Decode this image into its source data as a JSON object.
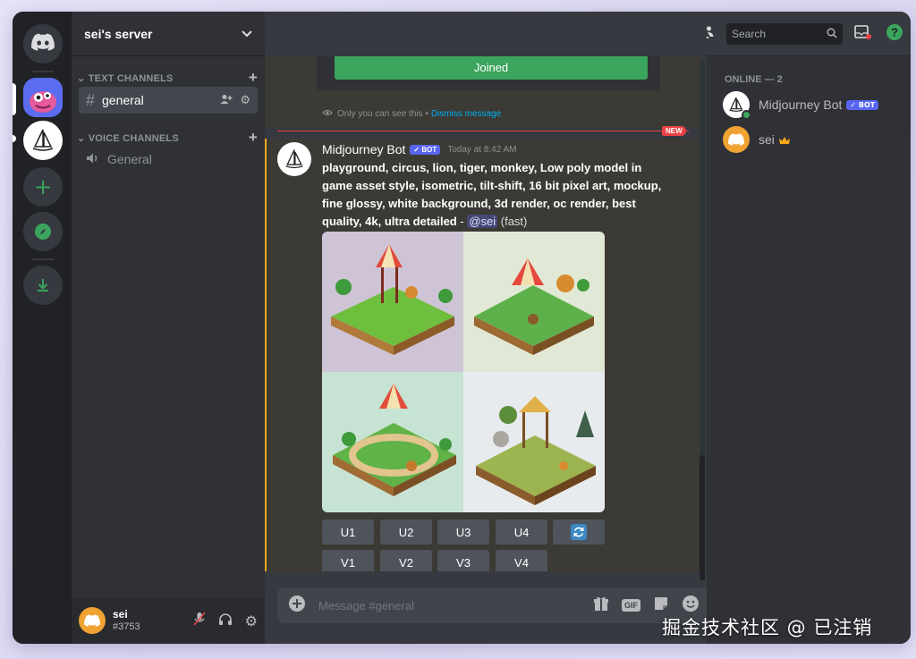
{
  "server": {
    "name": "sei's server"
  },
  "channels": {
    "text_category": "TEXT CHANNELS",
    "voice_category": "VOICE CHANNELS",
    "text_items": [
      {
        "label": "general"
      }
    ],
    "voice_items": [
      {
        "label": "General"
      }
    ]
  },
  "user": {
    "name": "sei",
    "tag": "#3753"
  },
  "header": {
    "channel": "general",
    "search_placeholder": "Search"
  },
  "prev_message": {
    "button_label": "Joined",
    "ephemeral_note": "Only you can see this •",
    "dismiss_label": "Dismiss message"
  },
  "new_divider": {
    "label": "NEW"
  },
  "message": {
    "author": "Midjourney Bot",
    "bot_badge": "BOT",
    "timestamp": "Today at 8:42 AM",
    "prompt": "playground, circus, lion, tiger, monkey, Low poly model in game asset style, isometric, tilt-shift, 16 bit pixel art, mockup, fine glossy, white background, 3d render, oc render, best quality, 4k, ultra detailed",
    "dash": " - ",
    "mention": "@sei",
    "mode": "(fast)",
    "upscale_buttons": [
      "U1",
      "U2",
      "U3",
      "U4"
    ],
    "variation_buttons": [
      "V1",
      "V2",
      "V3",
      "V4"
    ]
  },
  "composer": {
    "placeholder": "Message #general",
    "gif_label": "GIF"
  },
  "members": {
    "section": "ONLINE — 2",
    "list": [
      {
        "name": "Midjourney Bot",
        "badge": "BOT"
      },
      {
        "name": "sei"
      }
    ]
  },
  "watermark": "掘金技术社区 @ 已注销",
  "colors": {
    "accent": "#5865f2",
    "green": "#3ba55d",
    "highlight": "#faa81a",
    "new_red": "#ed4245"
  }
}
